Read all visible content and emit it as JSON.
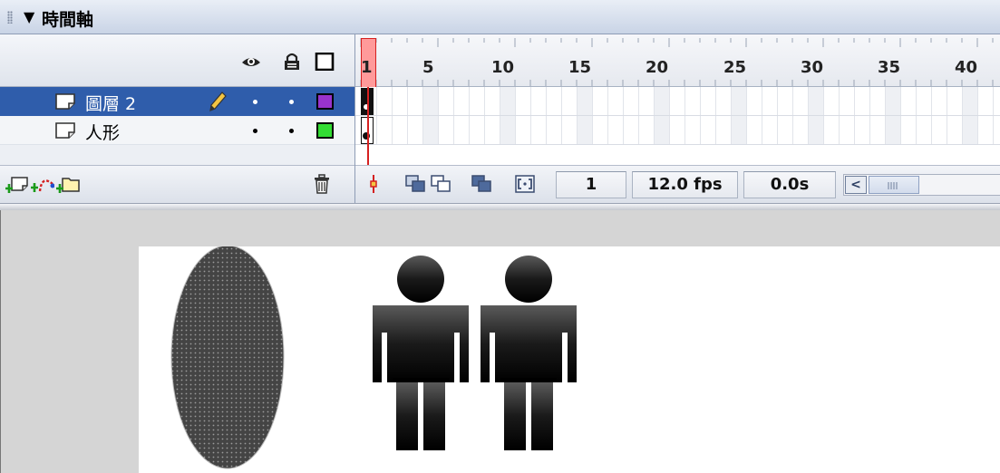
{
  "panel": {
    "collapse_glyph": "▼",
    "title": "時間軸"
  },
  "header_icons": [
    "eye-icon",
    "lock-icon",
    "outline-icon"
  ],
  "layers": [
    {
      "name": "圖層 2",
      "selected": true,
      "color": "#9933cc",
      "icon": "layer-icon",
      "edit_icon": "pencil-icon"
    },
    {
      "name": "人形",
      "selected": false,
      "color": "#33dd33",
      "icon": "layer-icon"
    }
  ],
  "frame_numbers": [
    "1",
    "5",
    "10",
    "15",
    "20",
    "25",
    "30",
    "35",
    "40"
  ],
  "layer_toolbar_icons": [
    "insert-layer-icon",
    "add-motion-guide-icon",
    "insert-layer-folder-icon",
    "delete-layer-icon"
  ],
  "timeline_toolbar_icons": [
    "center-frame-icon",
    "onion-skin-icon",
    "onion-skin-outlines-icon",
    "edit-multiple-frames-icon",
    "modify-onion-markers-icon"
  ],
  "status": {
    "current_frame": "1",
    "frame_rate": "12.0 fps",
    "elapsed_time": "0.0s"
  },
  "scrollbar": {
    "left_arrow": "<"
  },
  "stage": {
    "shapes": [
      "dotted-oval",
      "person-figure",
      "person-figure"
    ]
  }
}
